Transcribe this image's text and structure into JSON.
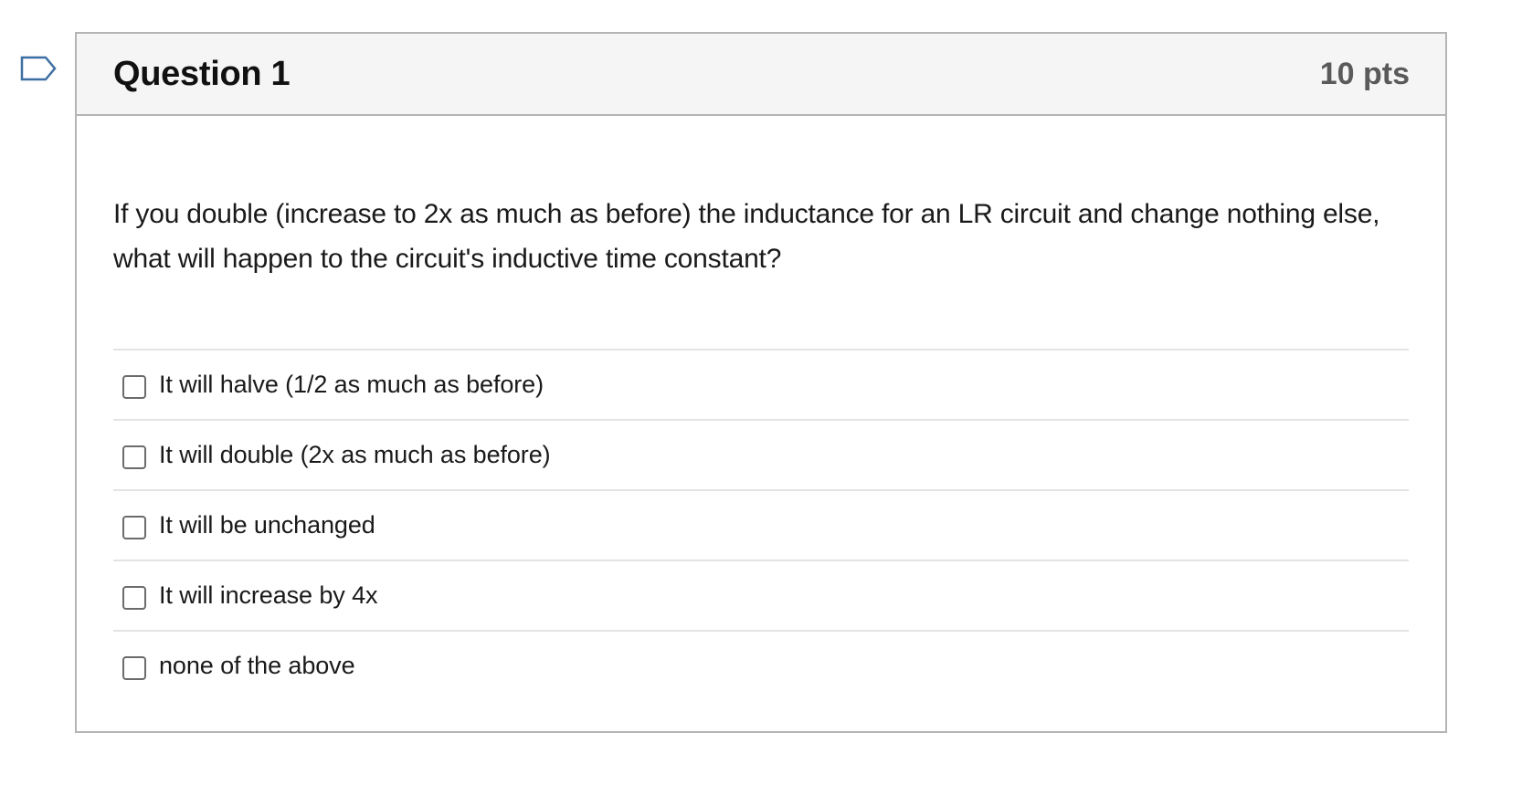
{
  "flag": {
    "icon": "bookmark-flag-icon",
    "color": "#3d6fa3"
  },
  "question": {
    "title": "Question 1",
    "points": "10 pts",
    "text": "If you double (increase to 2x as much as before) the inductance for an LR circuit and change nothing else, what will happen to the circuit's inductive time constant?",
    "answers": [
      {
        "label": "It will halve (1/2 as much as before)",
        "checked": false
      },
      {
        "label": "It will double (2x as much as before)",
        "checked": false
      },
      {
        "label": "It will be unchanged",
        "checked": false
      },
      {
        "label": "It will increase by 4x",
        "checked": false
      },
      {
        "label": "none of the above",
        "checked": false
      }
    ]
  }
}
